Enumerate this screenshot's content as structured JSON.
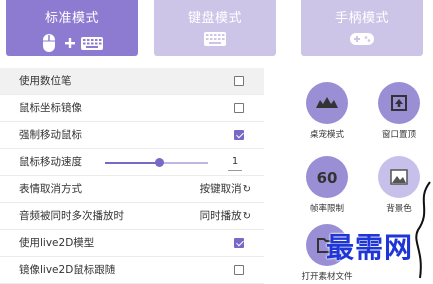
{
  "modes": [
    {
      "label": "标准模式",
      "icon": "mouse-keyboard-icon",
      "active": true
    },
    {
      "label": "键盘模式",
      "icon": "keyboard-icon",
      "active": false
    },
    {
      "label": "手柄模式",
      "icon": "gamepad-icon",
      "active": false
    }
  ],
  "settings": {
    "use_pen": {
      "label": "使用数位笔",
      "checked": false
    },
    "mouse_mirror": {
      "label": "鼠标坐标镜像",
      "checked": false
    },
    "force_move_mouse": {
      "label": "强制移动鼠标",
      "checked": true
    },
    "mouse_speed": {
      "label": "鼠标移动速度",
      "value": "1",
      "level": 0.52
    },
    "emoji_cancel": {
      "label": "表情取消方式",
      "value": "按键取消"
    },
    "audio_multi": {
      "label": "音频被同时多次播放时",
      "value": "同时播放"
    },
    "use_live2d": {
      "label": "使用live2D模型",
      "checked": true
    },
    "mirror_live2d": {
      "label": "镜像live2D鼠标跟随",
      "checked": false
    }
  },
  "tools": [
    {
      "caption": "桌宠模式",
      "icon": "desktop-pet-icon"
    },
    {
      "caption": "窗口置顶",
      "icon": "pin-top-icon"
    },
    {
      "caption": "帧率限制",
      "icon": "fps-60-icon",
      "glyph": "60"
    },
    {
      "caption": "背景色",
      "icon": "background-image-icon"
    },
    {
      "caption": "打开素材文件",
      "icon": "folder-icon"
    }
  ],
  "watermark": "最需网",
  "colors": {
    "accent": "#8d7bd1",
    "accent_light": "#cdc5e8",
    "check": "#7a68c7"
  }
}
